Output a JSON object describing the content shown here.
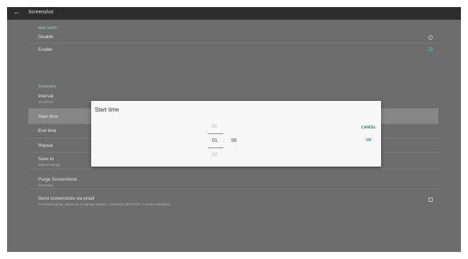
{
  "topbar": {
    "back_glyph": "←",
    "title": "Screenshot"
  },
  "main_switch": {
    "section_label": "Main Switch",
    "disable_label": "Disable",
    "enable_label": "Enable",
    "selected": "Enable"
  },
  "screenshot": {
    "section_label": "Screenshot",
    "interval": {
      "title": "Interval",
      "value": "30 minutes"
    },
    "start_time": {
      "title": "Start time"
    },
    "end_time": {
      "title": "End time"
    },
    "repeat": {
      "title": "Repeat"
    },
    "save_to": {
      "title": "Save to",
      "value": "Internal storage"
    },
    "purge": {
      "title": "Purge Screenshots",
      "value": "Every Day"
    },
    "email": {
      "title": "Send screenshots via email",
      "value": "For email settings, please go to Signage Display -> SERVER SETTINGS -> Email Notification.",
      "checked": false
    }
  },
  "dialog": {
    "title": "Start time",
    "hour_prev": "00",
    "hour": "01",
    "separator": ":",
    "minute": "56",
    "hour_next": "02",
    "cancel_label": "CANCEL",
    "ok_label": "OK"
  },
  "colors": {
    "accent": "#46b1b8",
    "section": "#9fd3c6",
    "background": "#6d6d6d"
  }
}
